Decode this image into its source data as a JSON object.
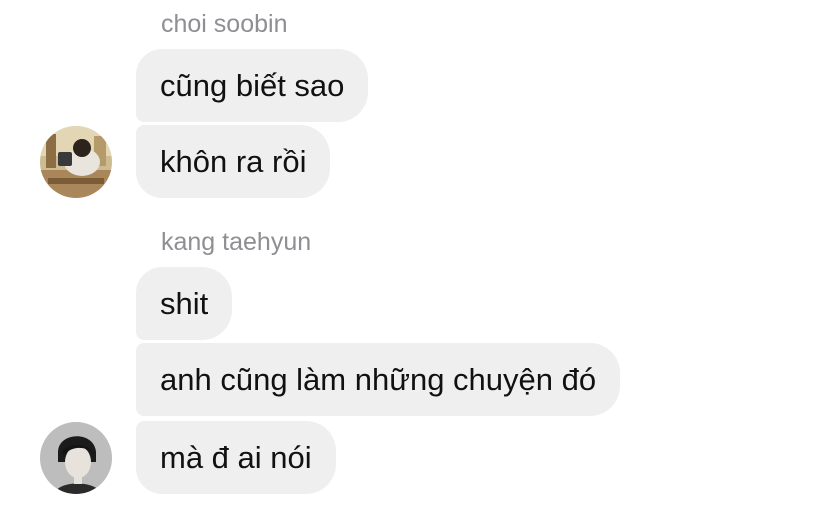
{
  "thread": {
    "groups": [
      {
        "sender": "choi soobin",
        "avatar_icon": "user-photo-avatar",
        "messages": [
          "cũng biết sao",
          "khôn ra rồi"
        ]
      },
      {
        "sender": "kang taehyun",
        "avatar_icon": "user-photo-avatar",
        "messages": [
          "shit",
          "anh cũng làm những chuyện đó",
          "mà đ ai nói"
        ]
      }
    ]
  },
  "colors": {
    "bubble_bg": "#efefef",
    "sender_text": "#8e8e93",
    "message_text": "#111111",
    "page_bg": "#ffffff"
  }
}
